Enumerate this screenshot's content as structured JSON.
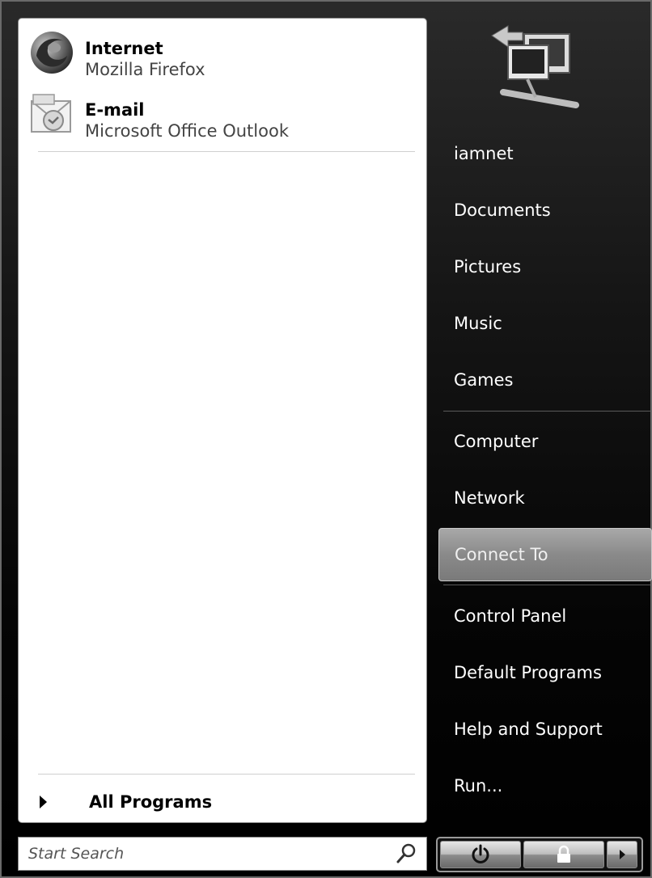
{
  "pinned": [
    {
      "title": "Internet",
      "subtitle": "Mozilla Firefox",
      "icon": "firefox-icon"
    },
    {
      "title": "E-mail",
      "subtitle": "Microsoft Office Outlook",
      "icon": "outlook-icon"
    }
  ],
  "all_programs": {
    "label": "All Programs"
  },
  "right_items": {
    "user": "iamnet",
    "documents": "Documents",
    "pictures": "Pictures",
    "music": "Music",
    "games": "Games",
    "computer": "Computer",
    "network": "Network",
    "connect_to": "Connect To",
    "control_panel": "Control Panel",
    "default_programs": "Default Programs",
    "help": "Help and Support",
    "run": "Run..."
  },
  "selected_item": "Connect To",
  "search": {
    "placeholder": "Start Search",
    "value": ""
  },
  "power": {
    "power_icon": "power-icon",
    "lock_icon": "lock-icon",
    "more_icon": "arrow-right-icon"
  }
}
